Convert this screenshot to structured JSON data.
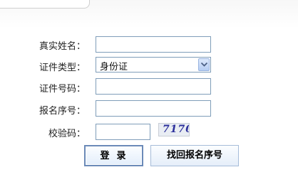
{
  "form": {
    "name_label": "真实姓名：",
    "id_type_label": "证件类型：",
    "id_type_value": "身份证",
    "id_number_label": "证件号码：",
    "reg_no_label": "报名序号：",
    "captcha_label": "校验码：",
    "captcha_text": "7170"
  },
  "buttons": {
    "login": "登录",
    "find_reg_no": "找回报名序号"
  }
}
